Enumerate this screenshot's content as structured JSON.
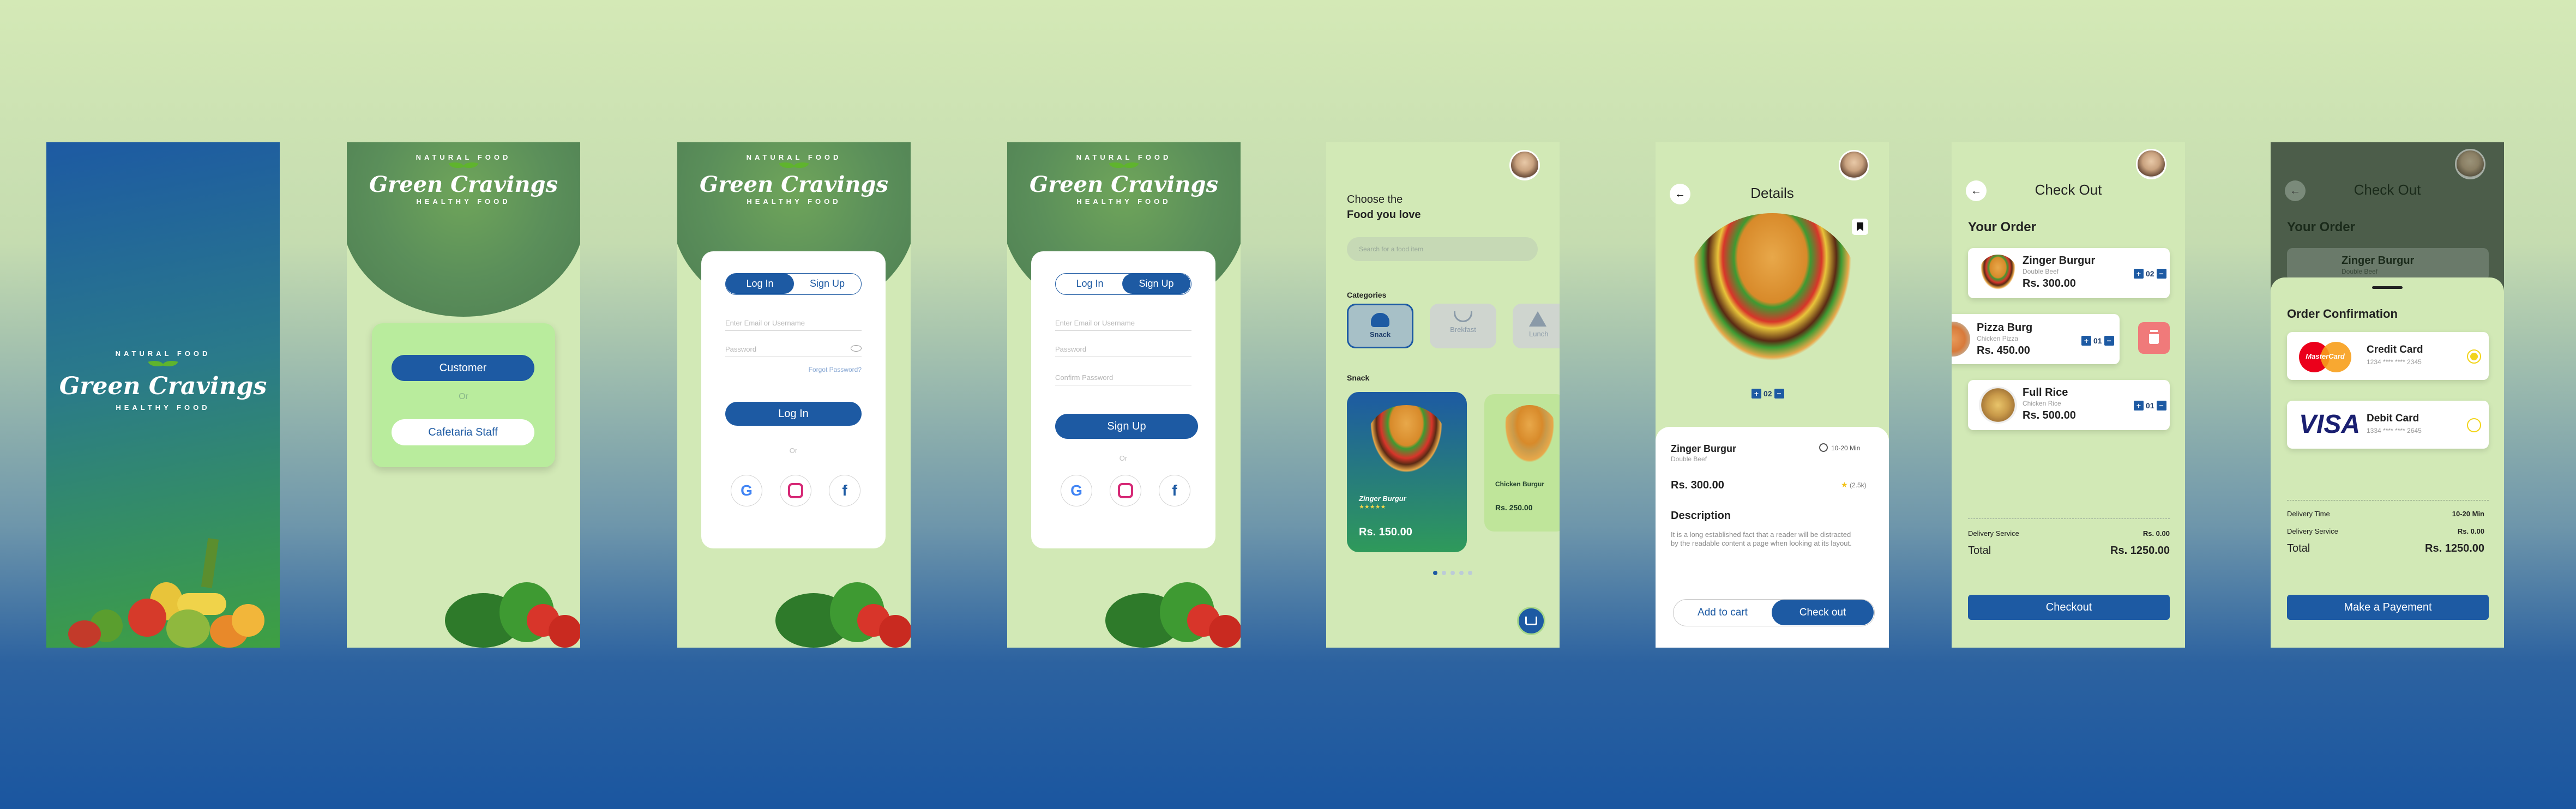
{
  "brand": {
    "name": "Green Cravings",
    "arc_top": "NATURAL FOOD",
    "arc_bottom": "HEALTHY FOOD"
  },
  "s2": {
    "customer": "Customer",
    "or": "Or",
    "staff": "Cafetaria Staff"
  },
  "login": {
    "tab_login": "Log In",
    "tab_signup": "Sign Up",
    "email_ph": "Enter Email or Username",
    "password_ph": "Password",
    "forgot": "Forgot Password?",
    "submit": "Log In",
    "or": "Or"
  },
  "signup": {
    "tab_login": "Log In",
    "tab_signup": "Sign Up",
    "email_ph": "Enter Email or Username",
    "password_ph": "Password",
    "confirm_ph": "Confirm Password",
    "submit": "Sign Up",
    "or": "Or"
  },
  "home": {
    "title1": "Choose the",
    "title2": "Food you love",
    "search_ph": "Search for a food item",
    "categories_label": "Categories",
    "categories": [
      {
        "label": "Snack"
      },
      {
        "label": "Brekfast"
      },
      {
        "label": "Lunch"
      }
    ],
    "section": "Snack",
    "items": [
      {
        "name": "Zinger Burgur",
        "stars": "★★★★★",
        "price": "Rs. 150.00"
      },
      {
        "name": "Chicken Burgur",
        "price": "Rs. 250.00"
      }
    ]
  },
  "details": {
    "title": "Details",
    "qty": "02",
    "name": "Zinger Burgur",
    "sub": "Double Beef",
    "time": "10-20 Min",
    "price": "Rs. 300.00",
    "rating": "(2.5k)",
    "desc_title": "Description",
    "desc": "It is a long established fact that a reader will be distracted by the readable content a page when looking at its layout.",
    "add_cart": "Add to cart",
    "checkout": "Check out"
  },
  "checkout": {
    "title": "Check Out",
    "your_order": "Your Order",
    "items": [
      {
        "name": "Zinger Burgur",
        "sub": "Double Beef",
        "price": "Rs. 300.00",
        "qty": "02"
      },
      {
        "name": "Pizza Burg",
        "sub": "Chicken Pizza",
        "price": "Rs. 450.00",
        "qty": "01"
      },
      {
        "name": "Full Rice",
        "sub": "Chicken Rice",
        "price": "Rs. 500.00",
        "qty": "01"
      }
    ],
    "delivery_label": "Delivery Service",
    "delivery_value": "Rs. 0.00",
    "total_label": "Total",
    "total_value": "Rs. 1250.00",
    "button": "Checkout"
  },
  "confirm": {
    "bg_title": "Check Out",
    "bg_order": "Your Order",
    "bg_item": "Zinger Burgur",
    "bg_sub": "Double Beef",
    "title": "Order Confirmation",
    "cards": [
      {
        "brand": "MasterCard",
        "name": "Credit Card",
        "number": "1234 **** **** 2345"
      },
      {
        "brand": "VISA",
        "name": "Debit Card",
        "number": "1334 **** **** 2645"
      }
    ],
    "time_label": "Delivery Time",
    "time_value": "10-20 Min",
    "delivery_label": "Delivery Service",
    "delivery_value": "Rs. 0.00",
    "total_label": "Total",
    "total_value": "Rs. 1250.00",
    "button": "Make a Payement"
  },
  "colors": {
    "primary": "#1d5aa3",
    "screen_bg": "#d2e9b6",
    "accent_green": "#5fb42d"
  }
}
